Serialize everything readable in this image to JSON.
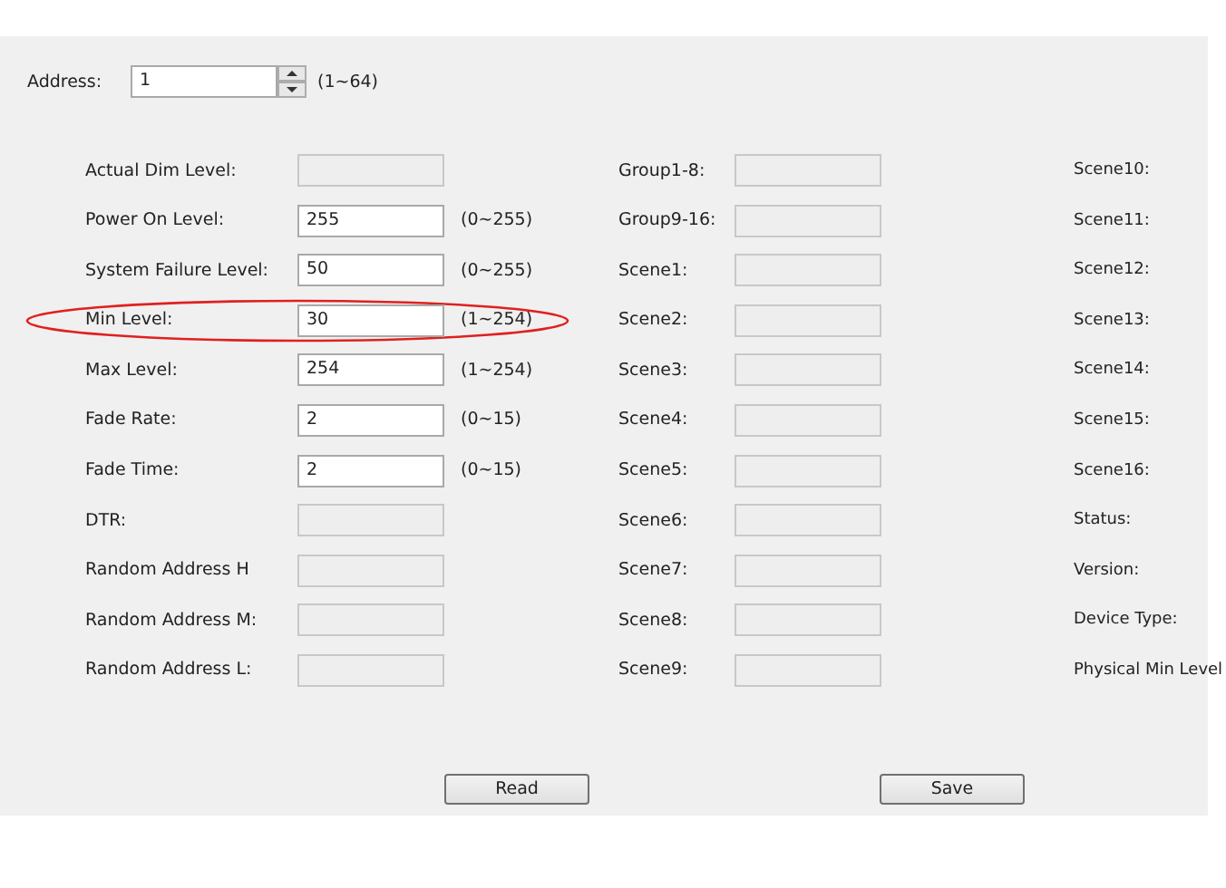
{
  "address": {
    "label": "Address:",
    "value": "1",
    "range": "(1~64)"
  },
  "left_rows": [
    {
      "label": "Actual Dim Level:",
      "value": "",
      "disabled": true,
      "highlighted": false
    },
    {
      "label": "Power On Level:",
      "value": "255",
      "range": "(0~255)",
      "disabled": false,
      "highlighted": false
    },
    {
      "label": "System Failure Level:",
      "value": "50",
      "range": "(0~255)",
      "disabled": false,
      "highlighted": false
    },
    {
      "label": "Min Level:",
      "value": "30",
      "range": "(1~254)",
      "disabled": false,
      "highlighted": true
    },
    {
      "label": "Max Level:",
      "value": "254",
      "range": "(1~254)",
      "disabled": false,
      "highlighted": false
    },
    {
      "label": "Fade Rate:",
      "value": "2",
      "range": "(0~15)",
      "disabled": false,
      "highlighted": false
    },
    {
      "label": "Fade Time:",
      "value": "2",
      "range": "(0~15)",
      "disabled": false,
      "highlighted": false
    },
    {
      "label": "DTR:",
      "value": "",
      "disabled": true,
      "highlighted": false
    },
    {
      "label": "Random Address H",
      "value": "",
      "disabled": true,
      "highlighted": false
    },
    {
      "label": "Random Address M:",
      "value": "",
      "disabled": true,
      "highlighted": false
    },
    {
      "label": "Random Address L:",
      "value": "",
      "disabled": true,
      "highlighted": false
    }
  ],
  "middle_rows": [
    {
      "label": "Group1-8:",
      "disabled": true
    },
    {
      "label": "Group9-16:",
      "disabled": true
    },
    {
      "label": "Scene1:",
      "disabled": true
    },
    {
      "label": "Scene2:",
      "disabled": true
    },
    {
      "label": "Scene3:",
      "disabled": true
    },
    {
      "label": "Scene4:",
      "disabled": true
    },
    {
      "label": "Scene5:",
      "disabled": true
    },
    {
      "label": "Scene6:",
      "disabled": true
    },
    {
      "label": "Scene7:",
      "disabled": true
    },
    {
      "label": "Scene8:",
      "disabled": true
    },
    {
      "label": "Scene9:",
      "disabled": true
    }
  ],
  "right_rows": [
    {
      "label": "Scene10:"
    },
    {
      "label": "Scene11:"
    },
    {
      "label": "Scene12:"
    },
    {
      "label": "Scene13:"
    },
    {
      "label": "Scene14:"
    },
    {
      "label": "Scene15:"
    },
    {
      "label": "Scene16:"
    },
    {
      "label": "Status:"
    },
    {
      "label": "Version:"
    },
    {
      "label": "Device Type:"
    },
    {
      "label": "Physical Min Level"
    }
  ],
  "buttons": [
    {
      "label": "Read"
    },
    {
      "label": "Save"
    }
  ]
}
